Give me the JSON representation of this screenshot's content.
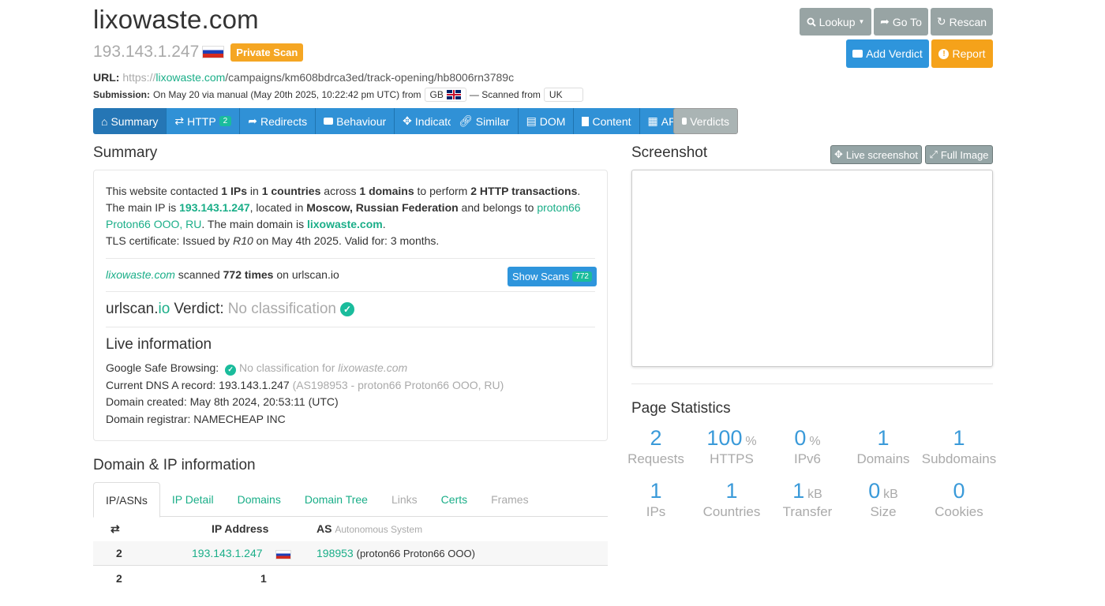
{
  "header": {
    "domain": "lixowaste.com",
    "ip": "193.143.1.247",
    "private_badge": "Private Scan",
    "url_label": "URL:",
    "url_scheme": "https://",
    "url_host": "lixowaste.com",
    "url_path": "/campaigns/km608bdrca3ed/track-opening/hb8006rn3789c",
    "submission_label": "Submission:",
    "submission_text": "On May 20 via manual (May 20th 2025, 10:22:42 pm UTC) from",
    "submission_country": "GB",
    "scanned_from_text": "— Scanned from",
    "scanned_from_country": "UK"
  },
  "actions": {
    "lookup": "Lookup",
    "goto": "Go To",
    "rescan": "Rescan",
    "add_verdict": "Add Verdict",
    "report": "Report"
  },
  "nav": {
    "summary": "Summary",
    "http": "HTTP",
    "http_count": "2",
    "redirects": "Redirects",
    "behaviour": "Behaviour",
    "indicators": "Indicators",
    "similar": "Similar",
    "dom": "DOM",
    "content": "Content",
    "api": "API",
    "verdicts": "Verdicts"
  },
  "summary": {
    "title": "Summary",
    "p1_a": "This website contacted ",
    "ips": "1 IPs",
    "p1_b": " in ",
    "countries": "1 countries",
    "p1_c": " across ",
    "domains": "1 domains",
    "p1_d": " to perform ",
    "transactions": "2 HTTP transactions",
    "p2_a": "The main IP is ",
    "main_ip": "193.143.1.247",
    "p2_b": ", located in ",
    "location": "Moscow, Russian Federation",
    "p2_c": " and belongs to ",
    "asn_owner": "proton66 Proton66 OOO, RU",
    "p2_d": ". The main domain is ",
    "main_domain": "lixowaste.com",
    "tls_a": "TLS certificate: Issued by ",
    "tls_issuer": "R10",
    "tls_b": " on May 4th 2025. Valid for: 3 months.",
    "scanned_domain": "lixowaste.com",
    "scanned_a": " scanned ",
    "scanned_times": "772 times",
    "scanned_b": " on urlscan.io",
    "show_scans": "Show Scans",
    "show_scans_count": "772",
    "verdict_brand_a": "urlscan.",
    "verdict_brand_b": "io",
    "verdict_label": "Verdict:",
    "verdict_value": "No classification",
    "live_title": "Live information",
    "gsb_label": "Google Safe Browsing:",
    "gsb_value": "No classification for",
    "gsb_domain": "lixowaste.com",
    "dns_label": "Current DNS A record: 193.143.1.247",
    "dns_as": "(AS198953 - proton66 Proton66 OOO, RU)",
    "created": "Domain created: May 8th 2024, 20:53:11 (UTC)",
    "registrar": "Domain registrar: NAMECHEAP INC"
  },
  "domain_ip": {
    "title": "Domain & IP information",
    "tabs": [
      "IP/ASNs",
      "IP Detail",
      "Domains",
      "Domain Tree",
      "Links",
      "Certs",
      "Frames"
    ],
    "col_ip": "IP Address",
    "col_as": "AS",
    "col_as_sub": "Autonomous System",
    "rows": [
      {
        "count": "2",
        "ip": "193.143.1.247",
        "as_num": "198953",
        "as_name": "(proton66 Proton66 OOO)"
      },
      {
        "count": "2",
        "ip": "1",
        "as_num": "",
        "as_name": ""
      }
    ]
  },
  "screenshot": {
    "title": "Screenshot",
    "live_btn": "Live screenshot",
    "full_btn": "Full Image"
  },
  "stats": {
    "title": "Page Statistics",
    "items": [
      {
        "value": "2",
        "unit": "",
        "label": "Requests"
      },
      {
        "value": "100",
        "unit": "%",
        "label": "HTTPS"
      },
      {
        "value": "0",
        "unit": "%",
        "label": "IPv6"
      },
      {
        "value": "1",
        "unit": "",
        "label": "Domains"
      },
      {
        "value": "1",
        "unit": "",
        "label": "Subdomains"
      },
      {
        "value": "1",
        "unit": "",
        "label": "IPs"
      },
      {
        "value": "1",
        "unit": "",
        "label": "Countries"
      },
      {
        "value": "1",
        "unit": "kB",
        "label": "Transfer"
      },
      {
        "value": "0",
        "unit": "kB",
        "label": "Size"
      },
      {
        "value": "0",
        "unit": "",
        "label": "Cookies"
      }
    ]
  }
}
